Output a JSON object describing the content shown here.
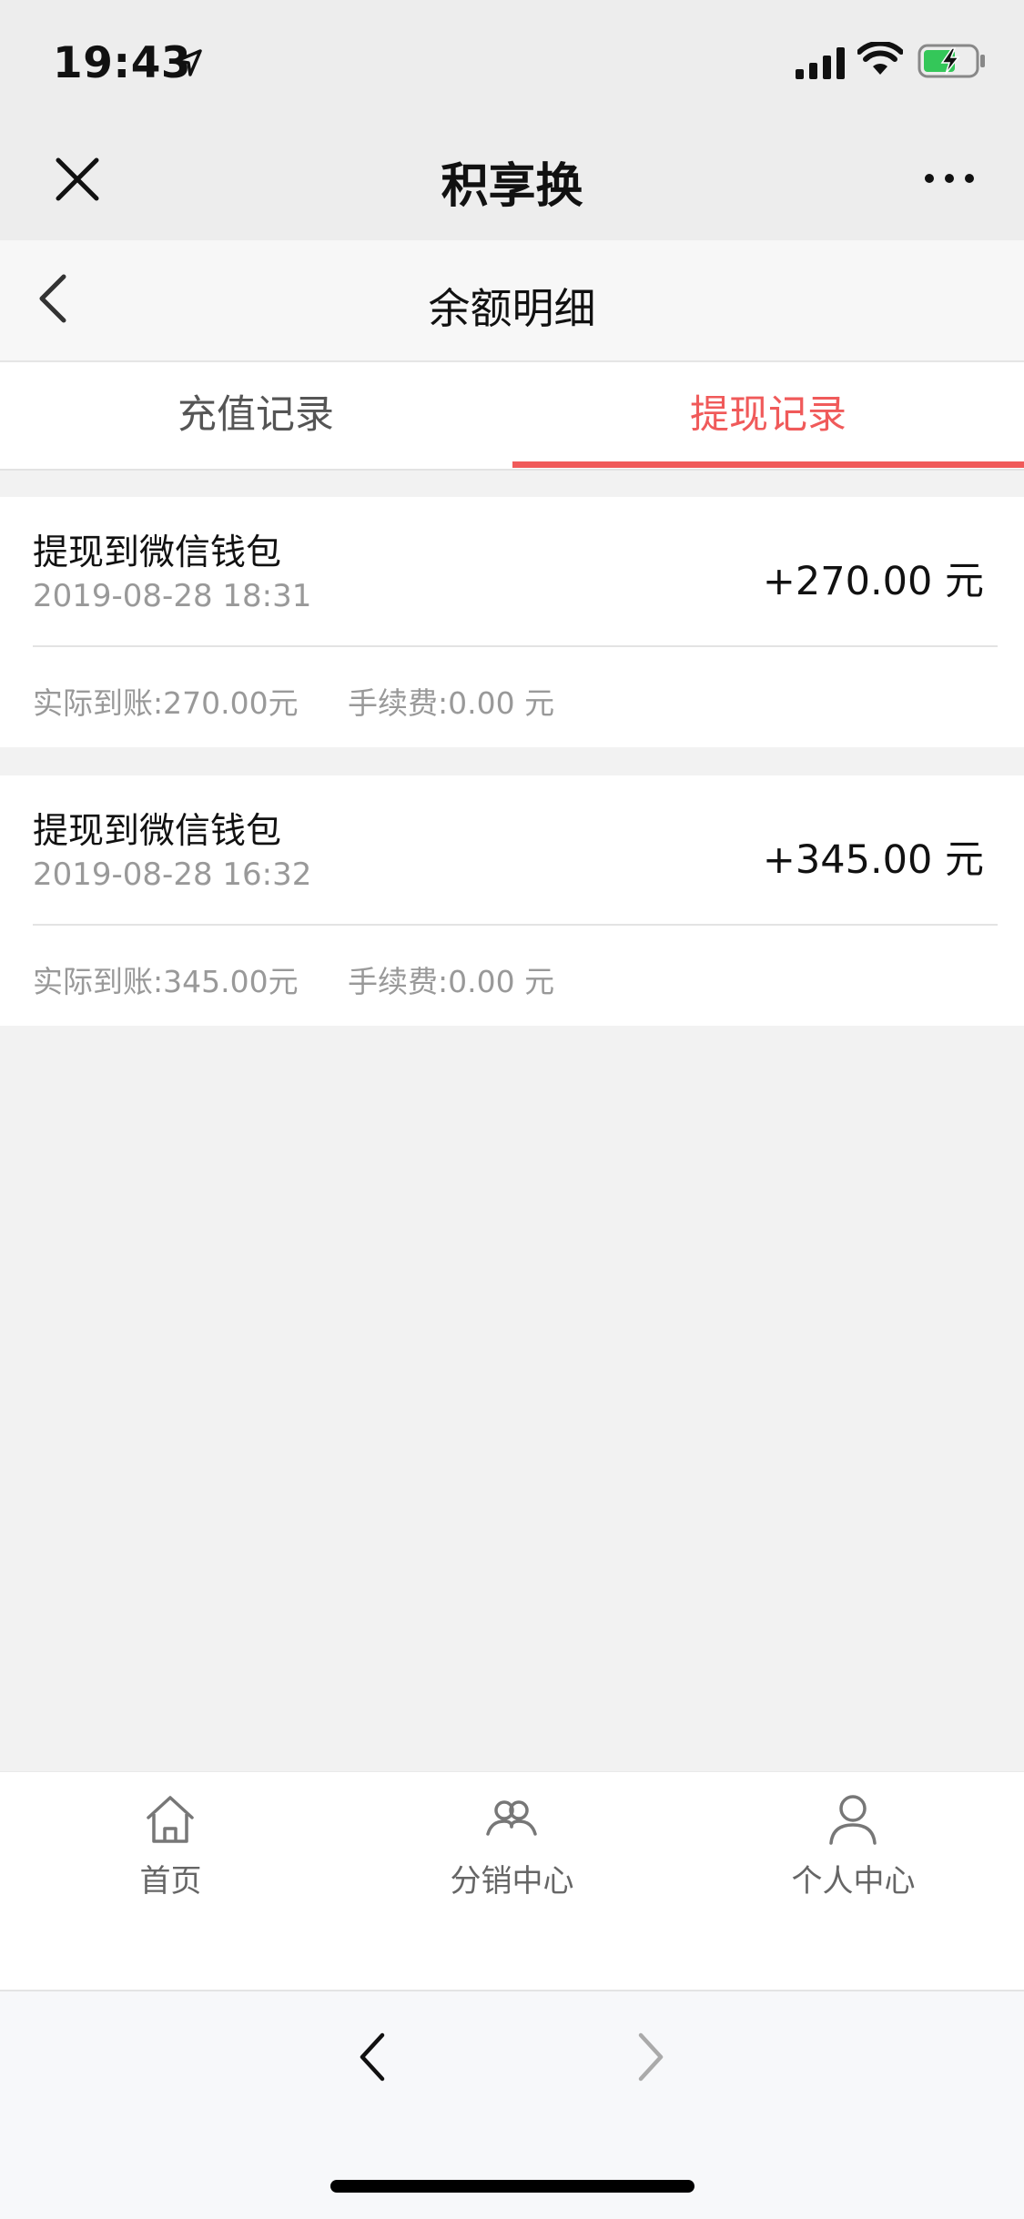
{
  "status_bar": {
    "time": "19:43",
    "icons": [
      "location-arrow-icon",
      "cellular-signal-icon",
      "wifi-icon",
      "battery-charging-icon"
    ],
    "battery_color": "#34c759"
  },
  "wechat_bar": {
    "title": "积享换",
    "close_icon": "close-icon",
    "more_icon": "more-icon"
  },
  "page": {
    "title": "余额明细",
    "back_icon": "back-icon"
  },
  "tabs": [
    {
      "label": "充值记录",
      "active": false
    },
    {
      "label": "提现记录",
      "active": true
    }
  ],
  "accent_color": "#f05a5a",
  "records": [
    {
      "title": "提现到微信钱包",
      "time": "2019-08-28 18:31",
      "amount": "+270.00 元",
      "actual": "实际到账:270.00元",
      "fee": "手续费:0.00 元"
    },
    {
      "title": "提现到微信钱包",
      "time": "2019-08-28 16:32",
      "amount": "+345.00 元",
      "actual": "实际到账:345.00元",
      "fee": "手续费:0.00 元"
    }
  ],
  "tabbar": [
    {
      "label": "首页",
      "icon": "home-icon"
    },
    {
      "label": "分销中心",
      "icon": "group-icon"
    },
    {
      "label": "个人中心",
      "icon": "user-icon"
    }
  ],
  "browser_nav": {
    "back_icon": "chevron-left-icon",
    "forward_icon": "chevron-right-icon"
  }
}
